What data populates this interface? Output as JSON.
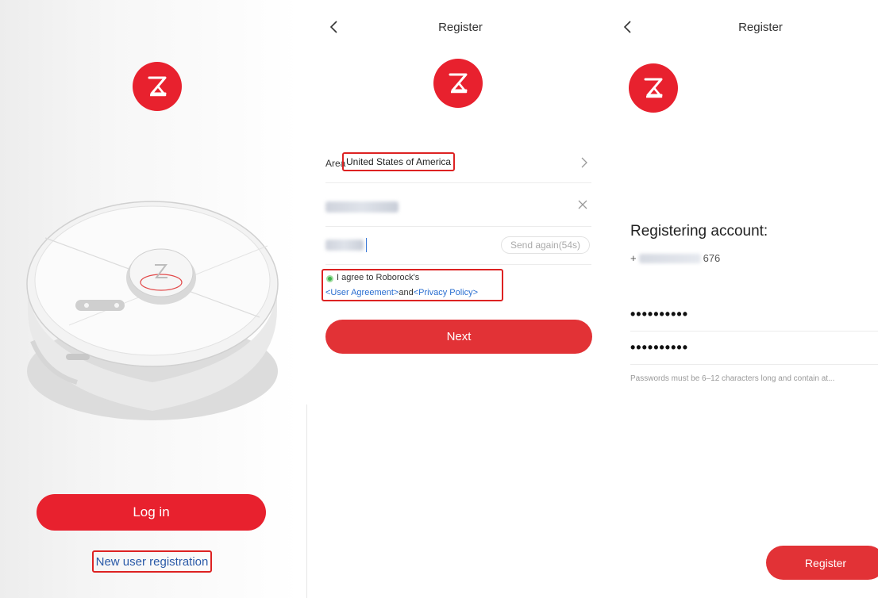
{
  "colors": {
    "brand_red": "#e8212e",
    "link_blue": "#2a6ed0",
    "highlight_border": "#dd2222"
  },
  "screen_login": {
    "login_label": "Log in",
    "registration_link": "New user registration"
  },
  "screen_register": {
    "title": "Register",
    "area_label": "Area",
    "area_value": "United States of America",
    "send_again_label": "Send again(54s)",
    "agree_text": "I agree to Roborock's",
    "user_agreement": "<User Agreement>",
    "and_text": "and",
    "privacy_policy": "<Privacy Policy>",
    "next_label": "Next"
  },
  "screen_account": {
    "title": "Register",
    "heading": "Registering account:",
    "phone_prefix": "+",
    "phone_suffix": "676",
    "password_mask": "••••••••••",
    "confirm_mask": "••••••••••",
    "hint": "Passwords must be 6–12 characters long and contain at...",
    "register_label": "Register"
  }
}
